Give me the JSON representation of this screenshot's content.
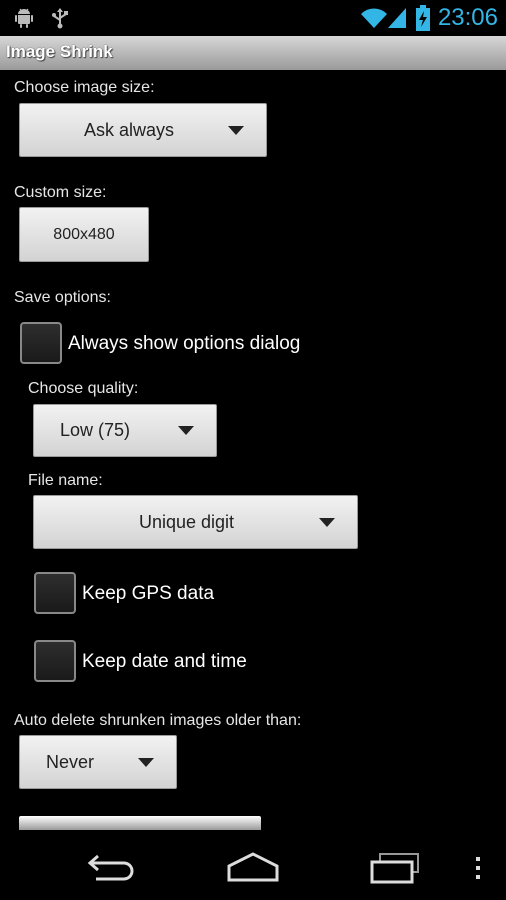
{
  "status": {
    "time": "23:06",
    "icons": [
      "android-debug-icon",
      "usb-icon",
      "wifi-icon",
      "signal-icon",
      "battery-charging-icon"
    ]
  },
  "actionbar": {
    "title": "Image Shrink"
  },
  "size": {
    "label": "Choose image size:",
    "value": "Ask always"
  },
  "custom": {
    "label": "Custom size:",
    "value": "800x480"
  },
  "save": {
    "label": "Save options:",
    "dialog_label": "Always show options dialog",
    "quality_label": "Choose quality:",
    "quality_value": "Low (75)",
    "filename_label": "File name:",
    "filename_value": "Unique digit",
    "gps_label": "Keep GPS data",
    "datetime_label": "Keep date and time"
  },
  "autodelete": {
    "label": "Auto delete shrunken images older than:",
    "value": "Never"
  },
  "nav": {
    "icons": [
      "back-icon",
      "home-icon",
      "recent-apps-icon",
      "menu-icon"
    ]
  }
}
